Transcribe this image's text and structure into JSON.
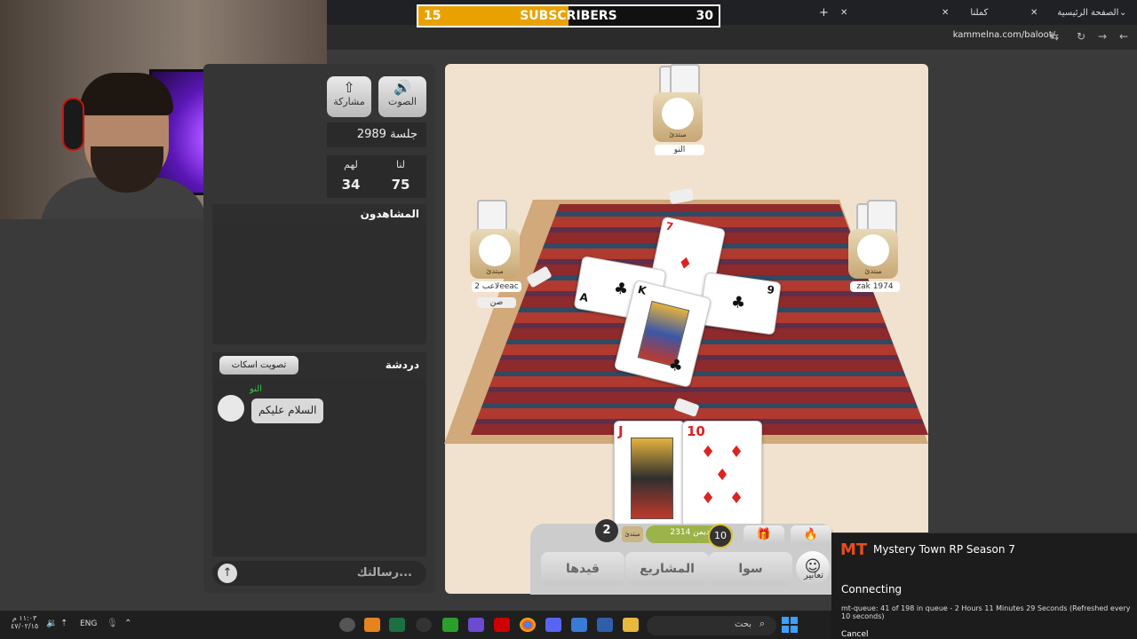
{
  "browser": {
    "tabs": [
      {
        "label": "الصفحة الرئيسية"
      },
      {
        "label": "كملنا"
      }
    ],
    "url": "kammelna.com/baloot/"
  },
  "subscribers": {
    "current": "15",
    "label": "SUBSCRIBERS",
    "goal": "30",
    "progress_fraction": 0.5,
    "fill_color": "#e9a100"
  },
  "panel": {
    "sound_label": "الصوت",
    "share_label": "مشاركة",
    "session_text": "جلسة 2989",
    "us_label": "لنا",
    "them_label": "لهم",
    "us_score": "75",
    "them_score": "34",
    "spectators_label": "المشاهدون",
    "chat_label": "دردشة",
    "mute_vote_label": "تصويت اسكات",
    "input_placeholder": "رسالتك..."
  },
  "chat": {
    "messages": [
      {
        "sender": "النو",
        "text": "السلام عليكم"
      }
    ]
  },
  "players": {
    "top": {
      "rank": "مبتدئ",
      "name": "النو"
    },
    "left": {
      "rank": "مبتدئ",
      "name": "لاعب 2eeac",
      "role": "صن"
    },
    "right": {
      "rank": "مبتدئ",
      "name": "zak 1974"
    }
  },
  "trick_cards": [
    {
      "rank": "7",
      "suit": "♦",
      "color": "red"
    },
    {
      "rank": "A",
      "suit": "♣",
      "color": "black"
    },
    {
      "rank": "9",
      "suit": "♣",
      "color": "black"
    },
    {
      "rank": "K",
      "suit": "♣",
      "color": "black"
    }
  ],
  "hand_cards": [
    {
      "rank": "J",
      "suit": "♦",
      "color": "red"
    },
    {
      "rank": "10",
      "suit": "♦",
      "color": "red"
    }
  ],
  "bottom": {
    "trick_count": "2",
    "rank_tag": "مبتدئ",
    "info_chip": "ملك ديمن 2314",
    "timer": "10",
    "btn_qaydha": "قيدها",
    "btn_projects": "المشاريع",
    "btn_sawa": "سوا",
    "emotes_label": "تعابير"
  },
  "notification": {
    "title": "Mystery Town RP Season 7",
    "status": "Connecting",
    "detail": "mt-queue: 41 of 198 in queue - 2 Hours 11 Minutes 29 Seconds (Refreshed every 10 seconds)",
    "cancel": "Cancel"
  },
  "taskbar": {
    "time": "١١:٠٣ م",
    "date": "٤٧/٠٢/١٥",
    "lang": "ENG",
    "search_placeholder": "بحث"
  }
}
